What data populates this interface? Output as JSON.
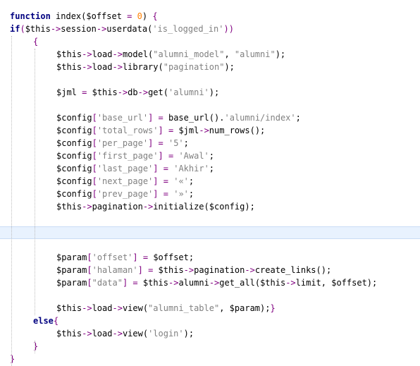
{
  "editor": {
    "current_line": 17,
    "lines": [
      {
        "indent": 0,
        "tokens": [
          {
            "t": "kw",
            "v": "function"
          },
          {
            "t": "fn",
            "v": " index("
          },
          {
            "t": "var",
            "v": "$offset"
          },
          {
            "t": "op",
            "v": " = "
          },
          {
            "t": "num",
            "v": "0"
          },
          {
            "t": "fn",
            "v": ") "
          },
          {
            "t": "p",
            "v": "{"
          }
        ]
      },
      {
        "indent": 0,
        "tokens": [
          {
            "t": "kw",
            "v": "if"
          },
          {
            "t": "p",
            "v": "("
          },
          {
            "t": "var",
            "v": "$this"
          },
          {
            "t": "op",
            "v": "->"
          },
          {
            "t": "fn",
            "v": "session"
          },
          {
            "t": "op",
            "v": "->"
          },
          {
            "t": "fn",
            "v": "userdata("
          },
          {
            "t": "str",
            "v": "'is_logged_in'"
          },
          {
            "t": "p",
            "v": "))"
          }
        ]
      },
      {
        "indent": 1,
        "tokens": [
          {
            "t": "p",
            "v": "{"
          }
        ]
      },
      {
        "indent": 2,
        "tokens": [
          {
            "t": "var",
            "v": "$this"
          },
          {
            "t": "op",
            "v": "->"
          },
          {
            "t": "fn",
            "v": "load"
          },
          {
            "t": "op",
            "v": "->"
          },
          {
            "t": "fn",
            "v": "model("
          },
          {
            "t": "str",
            "v": "\"alumni_model\""
          },
          {
            "t": "fn",
            "v": ", "
          },
          {
            "t": "str",
            "v": "\"alumni\""
          },
          {
            "t": "fn",
            "v": ");"
          }
        ]
      },
      {
        "indent": 2,
        "tokens": [
          {
            "t": "var",
            "v": "$this"
          },
          {
            "t": "op",
            "v": "->"
          },
          {
            "t": "fn",
            "v": "load"
          },
          {
            "t": "op",
            "v": "->"
          },
          {
            "t": "fn",
            "v": "library("
          },
          {
            "t": "str",
            "v": "\"pagination\""
          },
          {
            "t": "fn",
            "v": ");"
          }
        ]
      },
      {
        "indent": 2,
        "tokens": []
      },
      {
        "indent": 2,
        "tokens": [
          {
            "t": "var",
            "v": "$jml"
          },
          {
            "t": "op",
            "v": " = "
          },
          {
            "t": "var",
            "v": "$this"
          },
          {
            "t": "op",
            "v": "->"
          },
          {
            "t": "fn",
            "v": "db"
          },
          {
            "t": "op",
            "v": "->"
          },
          {
            "t": "fn",
            "v": "get("
          },
          {
            "t": "str",
            "v": "'alumni'"
          },
          {
            "t": "fn",
            "v": ");"
          }
        ]
      },
      {
        "indent": 2,
        "tokens": []
      },
      {
        "indent": 2,
        "tokens": [
          {
            "t": "var",
            "v": "$config"
          },
          {
            "t": "p",
            "v": "["
          },
          {
            "t": "str",
            "v": "'base_url'"
          },
          {
            "t": "p",
            "v": "]"
          },
          {
            "t": "op",
            "v": " = "
          },
          {
            "t": "fn",
            "v": "base_url()."
          },
          {
            "t": "str",
            "v": "'alumni/index'"
          },
          {
            "t": "fn",
            "v": ";"
          }
        ]
      },
      {
        "indent": 2,
        "tokens": [
          {
            "t": "var",
            "v": "$config"
          },
          {
            "t": "p",
            "v": "["
          },
          {
            "t": "str",
            "v": "'total_rows'"
          },
          {
            "t": "p",
            "v": "]"
          },
          {
            "t": "op",
            "v": " = "
          },
          {
            "t": "var",
            "v": "$jml"
          },
          {
            "t": "op",
            "v": "->"
          },
          {
            "t": "fn",
            "v": "num_rows();"
          }
        ]
      },
      {
        "indent": 2,
        "tokens": [
          {
            "t": "var",
            "v": "$config"
          },
          {
            "t": "p",
            "v": "["
          },
          {
            "t": "str",
            "v": "'per_page'"
          },
          {
            "t": "p",
            "v": "]"
          },
          {
            "t": "op",
            "v": " = "
          },
          {
            "t": "str",
            "v": "'5'"
          },
          {
            "t": "fn",
            "v": ";"
          }
        ]
      },
      {
        "indent": 2,
        "tokens": [
          {
            "t": "var",
            "v": "$config"
          },
          {
            "t": "p",
            "v": "["
          },
          {
            "t": "str",
            "v": "'first_page'"
          },
          {
            "t": "p",
            "v": "]"
          },
          {
            "t": "op",
            "v": " = "
          },
          {
            "t": "str",
            "v": "'Awal'"
          },
          {
            "t": "fn",
            "v": ";"
          }
        ]
      },
      {
        "indent": 2,
        "tokens": [
          {
            "t": "var",
            "v": "$config"
          },
          {
            "t": "p",
            "v": "["
          },
          {
            "t": "str",
            "v": "'last_page'"
          },
          {
            "t": "p",
            "v": "]"
          },
          {
            "t": "op",
            "v": " = "
          },
          {
            "t": "str",
            "v": "'Akhir'"
          },
          {
            "t": "fn",
            "v": ";"
          }
        ]
      },
      {
        "indent": 2,
        "tokens": [
          {
            "t": "var",
            "v": "$config"
          },
          {
            "t": "p",
            "v": "["
          },
          {
            "t": "str",
            "v": "'next_page'"
          },
          {
            "t": "p",
            "v": "]"
          },
          {
            "t": "op",
            "v": " = "
          },
          {
            "t": "str",
            "v": "'«'"
          },
          {
            "t": "fn",
            "v": ";"
          }
        ]
      },
      {
        "indent": 2,
        "tokens": [
          {
            "t": "var",
            "v": "$config"
          },
          {
            "t": "p",
            "v": "["
          },
          {
            "t": "str",
            "v": "'prev_page'"
          },
          {
            "t": "p",
            "v": "]"
          },
          {
            "t": "op",
            "v": " = "
          },
          {
            "t": "str",
            "v": "'»'"
          },
          {
            "t": "fn",
            "v": ";"
          }
        ]
      },
      {
        "indent": 2,
        "tokens": [
          {
            "t": "var",
            "v": "$this"
          },
          {
            "t": "op",
            "v": "->"
          },
          {
            "t": "fn",
            "v": "pagination"
          },
          {
            "t": "op",
            "v": "->"
          },
          {
            "t": "fn",
            "v": "initialize("
          },
          {
            "t": "var",
            "v": "$config"
          },
          {
            "t": "fn",
            "v": ");"
          }
        ]
      },
      {
        "indent": 2,
        "tokens": []
      },
      {
        "indent": 2,
        "tokens": []
      },
      {
        "indent": 2,
        "tokens": []
      },
      {
        "indent": 2,
        "tokens": [
          {
            "t": "var",
            "v": "$param"
          },
          {
            "t": "p",
            "v": "["
          },
          {
            "t": "str",
            "v": "'offset'"
          },
          {
            "t": "p",
            "v": "]"
          },
          {
            "t": "op",
            "v": " = "
          },
          {
            "t": "var",
            "v": "$offset"
          },
          {
            "t": "fn",
            "v": ";"
          }
        ]
      },
      {
        "indent": 2,
        "tokens": [
          {
            "t": "var",
            "v": "$param"
          },
          {
            "t": "p",
            "v": "["
          },
          {
            "t": "str",
            "v": "'halaman'"
          },
          {
            "t": "p",
            "v": "]"
          },
          {
            "t": "op",
            "v": " = "
          },
          {
            "t": "var",
            "v": "$this"
          },
          {
            "t": "op",
            "v": "->"
          },
          {
            "t": "fn",
            "v": "pagination"
          },
          {
            "t": "op",
            "v": "->"
          },
          {
            "t": "fn",
            "v": "create_links();"
          }
        ]
      },
      {
        "indent": 2,
        "tokens": [
          {
            "t": "var",
            "v": "$param"
          },
          {
            "t": "p",
            "v": "["
          },
          {
            "t": "str",
            "v": "\"data\""
          },
          {
            "t": "p",
            "v": "]"
          },
          {
            "t": "op",
            "v": " = "
          },
          {
            "t": "var",
            "v": "$this"
          },
          {
            "t": "op",
            "v": "->"
          },
          {
            "t": "fn",
            "v": "alumni"
          },
          {
            "t": "op",
            "v": "->"
          },
          {
            "t": "fn",
            "v": "get_all("
          },
          {
            "t": "var",
            "v": "$this"
          },
          {
            "t": "op",
            "v": "->"
          },
          {
            "t": "fn",
            "v": "limit, "
          },
          {
            "t": "var",
            "v": "$offset"
          },
          {
            "t": "fn",
            "v": ");"
          }
        ]
      },
      {
        "indent": 2,
        "tokens": []
      },
      {
        "indent": 2,
        "tokens": [
          {
            "t": "var",
            "v": "$this"
          },
          {
            "t": "op",
            "v": "->"
          },
          {
            "t": "fn",
            "v": "load"
          },
          {
            "t": "op",
            "v": "->"
          },
          {
            "t": "fn",
            "v": "view("
          },
          {
            "t": "str",
            "v": "\"alumni_table\""
          },
          {
            "t": "fn",
            "v": ", "
          },
          {
            "t": "var",
            "v": "$param"
          },
          {
            "t": "fn",
            "v": ");"
          },
          {
            "t": "p",
            "v": "}"
          }
        ]
      },
      {
        "indent": 1,
        "tokens": [
          {
            "t": "kw",
            "v": "else"
          },
          {
            "t": "p",
            "v": "{"
          }
        ]
      },
      {
        "indent": 2,
        "tokens": [
          {
            "t": "var",
            "v": "$this"
          },
          {
            "t": "op",
            "v": "->"
          },
          {
            "t": "fn",
            "v": "load"
          },
          {
            "t": "op",
            "v": "->"
          },
          {
            "t": "fn",
            "v": "view("
          },
          {
            "t": "str",
            "v": "'login'"
          },
          {
            "t": "fn",
            "v": ");"
          }
        ]
      },
      {
        "indent": 1,
        "tokens": [
          {
            "t": "p",
            "v": "}"
          }
        ]
      },
      {
        "indent": 0,
        "tokens": [
          {
            "t": "p",
            "v": "}"
          }
        ]
      }
    ]
  }
}
